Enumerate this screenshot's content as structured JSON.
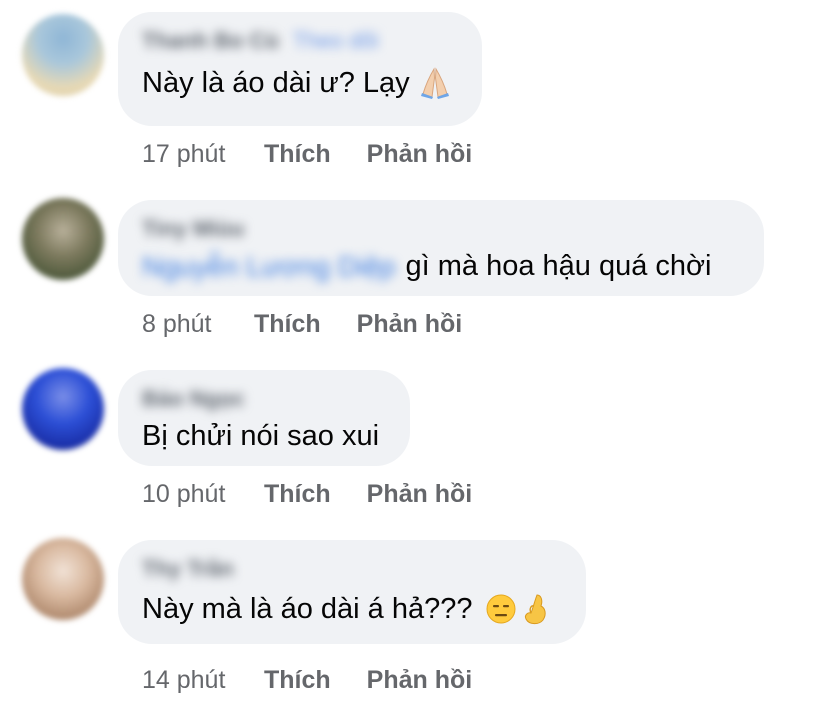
{
  "comments": [
    {
      "author": "Thanh Bo Cù",
      "tag": "Theo dõi",
      "text": "Này là áo dài ư? Lạy",
      "time": "17 phút",
      "like": "Thích",
      "reply": "Phản hồi"
    },
    {
      "author": "Tiny Miùu",
      "mention": "Nguyễn Lương Diệp",
      "text": "gì mà hoa hậu quá chời",
      "time": "8 phút",
      "like": "Thích",
      "reply": "Phản hồi"
    },
    {
      "author": "Bảo Ngọc",
      "text": "Bị chửi nói sao xui",
      "time": "10 phút",
      "like": "Thích",
      "reply": "Phản hồi"
    },
    {
      "author": "Thy Trần",
      "text": "Này mà là áo dài á hả???",
      "time": "14 phút",
      "like": "Thích",
      "reply": "Phản hồi"
    }
  ],
  "emojis": {
    "c1": "folded-hands",
    "c4a": "expressionless-face",
    "c4b": "pinching-hand"
  }
}
